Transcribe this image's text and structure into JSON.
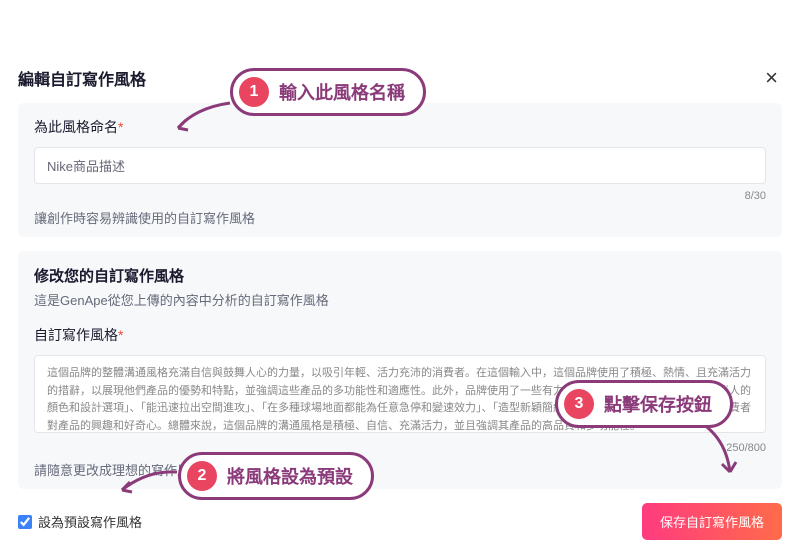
{
  "modal": {
    "title": "編輯自訂寫作風格",
    "close": "×"
  },
  "nameSection": {
    "label": "為此風格命名",
    "value": "Nike商品描述",
    "counter": "8/30",
    "help": "讓創作時容易辨識使用的自訂寫作風格"
  },
  "styleSection": {
    "title": "修改您的自訂寫作風格",
    "subtitle": "這是GenApe從您上傳的內容中分析的自訂寫作風格",
    "label": "自訂寫作風格",
    "value": "這個品牌的整體溝通風格充滿自信與鼓舞人心的力量，以吸引年輕、活力充沛的消費者。在這個輸入中，這個品牌使用了積極、熱情、且充滿活力的措辭，以展現他們產品的優勢和特點，並強調這些產品的多功能性和適應性。此外，品牌使用了一些有力的形容詞和形容詞詞組，例如「迷人的顏色和設計選項」、「能迅速拉出空間進攻」、「在多種球場地面都能為任意急停和變速效力」、「造型新穎簡約」、「更添前衛感」等等，以提高消費者對產品的興趣和好奇心。總體來說，這個品牌的溝通風格是積極、自信、充滿活力，並且強調其產品的高品質和多功能性。",
    "counter": "250/800",
    "help": "請隨意更改成理想的寫作風格"
  },
  "footer": {
    "checkboxLabel": "設為預設寫作風格",
    "saveButton": "保存自訂寫作風格"
  },
  "callouts": {
    "c1": {
      "num": "1",
      "text": "輸入此風格名稱"
    },
    "c2": {
      "num": "2",
      "text": "將風格設為預設"
    },
    "c3": {
      "num": "3",
      "text": "點擊保存按鈕"
    }
  }
}
